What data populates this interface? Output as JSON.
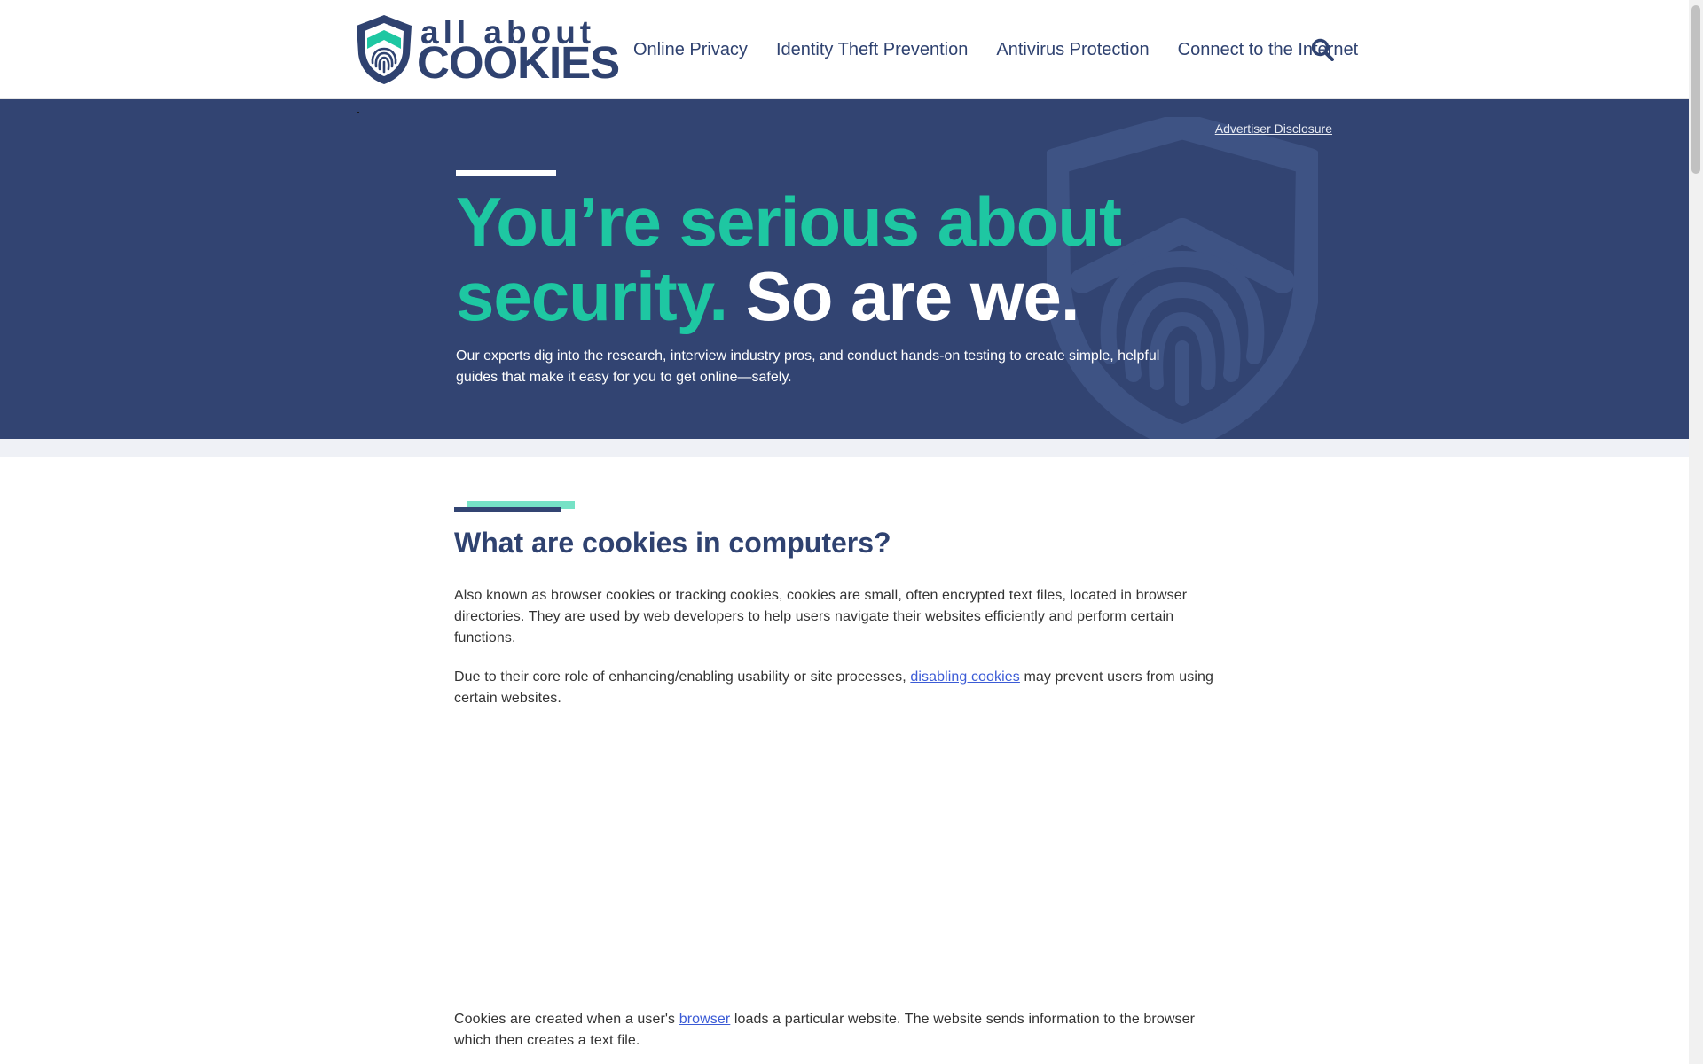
{
  "brand": {
    "logo_top": "all about",
    "logo_bottom": "COOKIES"
  },
  "nav": {
    "items": [
      {
        "label": "Online Privacy"
      },
      {
        "label": "Identity Theft Prevention"
      },
      {
        "label": "Antivirus Protection"
      },
      {
        "label": "Connect to the Internet"
      }
    ],
    "search_icon": "search-icon"
  },
  "hero": {
    "disclosure": "Advertiser Disclosure",
    "title_teal": "You’re serious about security.",
    "title_white": "So are we.",
    "subtitle": "Our experts dig into the research, interview industry pros, and conduct hands-on testing to create simple, helpful guides that make it easy for you to get online—safely."
  },
  "article": {
    "heading": "What are cookies in computers?",
    "p1": "Also known as browser cookies or tracking cookies, cookies are small, often encrypted text files, located in browser directories. They are used by web developers to help users navigate their websites efficiently and perform certain functions.",
    "p2_before": "Due to their core role of enhancing/enabling usability or site processes, ",
    "p2_link": "disabling cookies",
    "p2_after": " may prevent users from using certain websites.",
    "p3_before": "Cookies are created when a user's ",
    "p3_link": "browser",
    "p3_after": " loads a particular website. The website sends information to the browser which then creates a text file."
  },
  "colors": {
    "navy": "#324472",
    "teal": "#1ec7a2",
    "accent_teal": "#76e2c6",
    "link": "#3b5bd6"
  }
}
